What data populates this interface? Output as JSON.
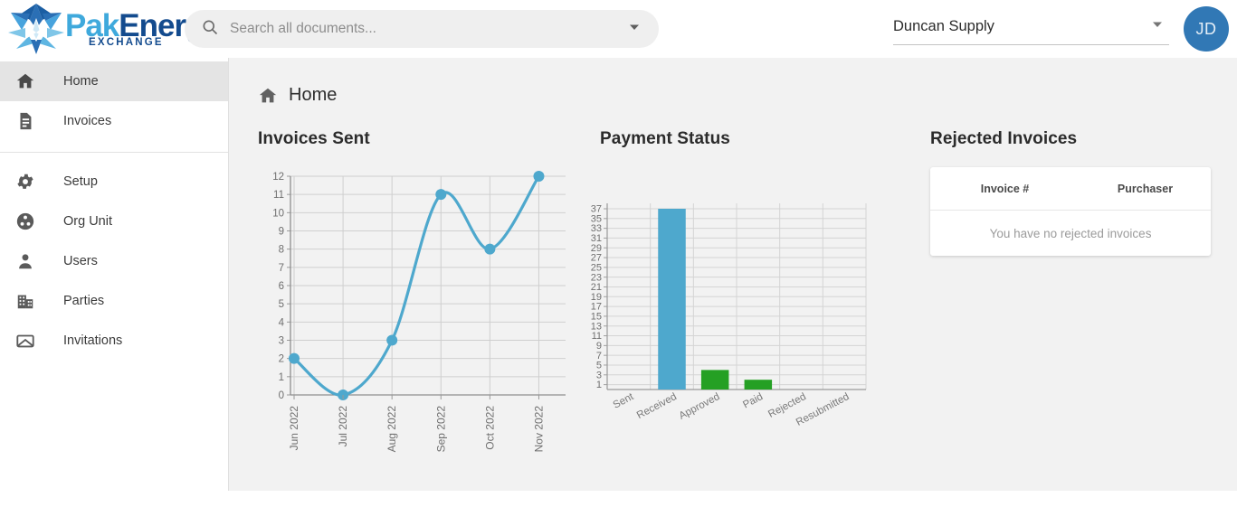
{
  "brand": {
    "logo_pak": "Pak",
    "logo_energy": "Energy",
    "logo_sub": "EXCHANGE",
    "color_light_blue": "#3fa9dc",
    "color_dark_blue": "#134b8e"
  },
  "search": {
    "placeholder": "Search all documents...",
    "value": "",
    "icon": "search-icon",
    "dropdown_icon": "chevron-down-icon"
  },
  "org": {
    "selected": "Duncan Supply",
    "dropdown_icon": "chevron-down-icon"
  },
  "avatar": {
    "initials": "JD",
    "color": "#3178b5"
  },
  "sidebar": {
    "items": [
      {
        "label": "Home",
        "icon": "home-icon",
        "active": true
      },
      {
        "label": "Invoices",
        "icon": "document-icon",
        "active": false
      },
      {
        "label": "Setup",
        "icon": "gear-icon",
        "active": false
      },
      {
        "label": "Org Unit",
        "icon": "org-unit-icon",
        "active": false
      },
      {
        "label": "Users",
        "icon": "person-icon",
        "active": false
      },
      {
        "label": "Parties",
        "icon": "building-icon",
        "active": false
      },
      {
        "label": "Invitations",
        "icon": "envelope-icon",
        "active": false
      }
    ]
  },
  "breadcrumb": {
    "label": "Home",
    "icon": "home-icon"
  },
  "panels": {
    "invoices_sent_title": "Invoices Sent",
    "payment_status_title": "Payment Status",
    "rejected_title": "Rejected Invoices"
  },
  "rejected_table": {
    "columns": [
      "Invoice #",
      "Purchaser"
    ],
    "rows": [],
    "empty_message": "You have no rejected invoices"
  },
  "chart_data": [
    {
      "type": "line",
      "title": "Invoices Sent",
      "xlabel": "",
      "ylabel": "",
      "categories": [
        "Jun 2022",
        "Jul 2022",
        "Aug 2022",
        "Sep 2022",
        "Oct 2022",
        "Nov 2022"
      ],
      "values": [
        2,
        0,
        3,
        11,
        8,
        12
      ],
      "ylim": [
        0,
        12
      ],
      "yticks": [
        0,
        1,
        2,
        3,
        4,
        5,
        6,
        7,
        8,
        9,
        10,
        11,
        12
      ],
      "grid": true,
      "legend": "none",
      "color": "#4ea8cd",
      "marker": "circle",
      "curve": "smooth"
    },
    {
      "type": "bar",
      "title": "Payment Status",
      "xlabel": "",
      "ylabel": "",
      "categories": [
        "Sent",
        "Received",
        "Approved",
        "Paid",
        "Rejected",
        "Resubmitted"
      ],
      "values": [
        0,
        37,
        4,
        2,
        0,
        0
      ],
      "colors": [
        "#4ea8cd",
        "#4ea8cd",
        "#25a024",
        "#25a024",
        "#25a024",
        "#25a024"
      ],
      "ylim": [
        0,
        37
      ],
      "yticks": [
        1,
        3,
        5,
        7,
        9,
        11,
        13,
        15,
        17,
        19,
        21,
        23,
        25,
        27,
        29,
        31,
        33,
        35,
        37
      ],
      "grid": true,
      "legend": "none"
    }
  ]
}
